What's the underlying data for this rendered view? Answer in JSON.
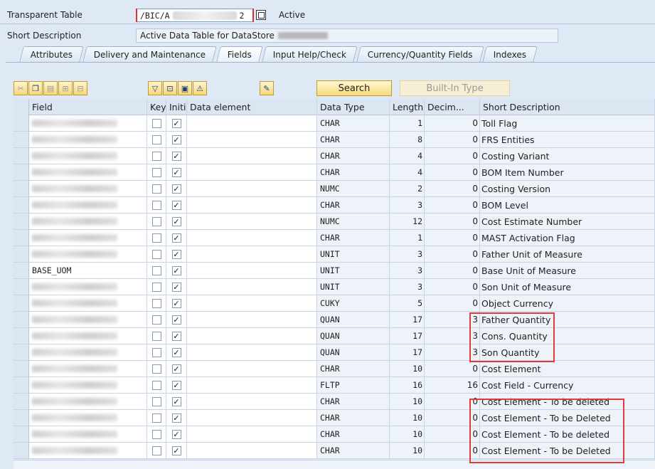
{
  "header": {
    "transparent_table_label": "Transparent Table",
    "table_name_prefix": "/BIC/A",
    "table_name_suffix": "2",
    "status": "Active",
    "short_description_label": "Short Description",
    "short_description_value": "Active Data Table for DataStore"
  },
  "tabs": [
    {
      "label": "Attributes"
    },
    {
      "label": "Delivery and Maintenance"
    },
    {
      "label": "Fields"
    },
    {
      "label": "Input Help/Check"
    },
    {
      "label": "Currency/Quantity Fields"
    },
    {
      "label": "Indexes"
    }
  ],
  "active_tab": "Fields",
  "toolbar": {
    "search_label": "Search",
    "builtin_type_label": "Built-In Type"
  },
  "columns": {
    "field": "Field",
    "key": "Key",
    "initial": "Initi...",
    "data_element": "Data element",
    "data_type": "Data Type",
    "length": "Length",
    "decimals": "Decim...",
    "short_description": "Short Description"
  },
  "rows": [
    {
      "field": "",
      "key": false,
      "initial": true,
      "data_element": "",
      "data_type": "CHAR",
      "length": "1",
      "decimals": "0",
      "short_description": "Toll Flag"
    },
    {
      "field": "",
      "key": false,
      "initial": true,
      "data_element": "",
      "data_type": "CHAR",
      "length": "8",
      "decimals": "0",
      "short_description": "FRS Entities"
    },
    {
      "field": "",
      "key": false,
      "initial": true,
      "data_element": "",
      "data_type": "CHAR",
      "length": "4",
      "decimals": "0",
      "short_description": "Costing Variant"
    },
    {
      "field": "",
      "key": false,
      "initial": true,
      "data_element": "",
      "data_type": "CHAR",
      "length": "4",
      "decimals": "0",
      "short_description": "BOM Item Number"
    },
    {
      "field": "",
      "key": false,
      "initial": true,
      "data_element": "",
      "data_type": "NUMC",
      "length": "2",
      "decimals": "0",
      "short_description": "Costing Version"
    },
    {
      "field": "",
      "key": false,
      "initial": true,
      "data_element": "",
      "data_type": "CHAR",
      "length": "3",
      "decimals": "0",
      "short_description": "BOM Level"
    },
    {
      "field": "",
      "key": false,
      "initial": true,
      "data_element": "",
      "data_type": "NUMC",
      "length": "12",
      "decimals": "0",
      "short_description": "Cost Estimate Number"
    },
    {
      "field": "",
      "key": false,
      "initial": true,
      "data_element": "",
      "data_type": "CHAR",
      "length": "1",
      "decimals": "0",
      "short_description": "MAST Activation Flag"
    },
    {
      "field": "",
      "key": false,
      "initial": true,
      "data_element": "",
      "data_type": "UNIT",
      "length": "3",
      "decimals": "0",
      "short_description": "Father Unit of Measure"
    },
    {
      "field": "BASE_UOM",
      "key": false,
      "initial": true,
      "data_element": "",
      "data_type": "UNIT",
      "length": "3",
      "decimals": "0",
      "short_description": "Base Unit of Measure"
    },
    {
      "field": "",
      "key": false,
      "initial": true,
      "data_element": "",
      "data_type": "UNIT",
      "length": "3",
      "decimals": "0",
      "short_description": "Son Unit of Measure"
    },
    {
      "field": "",
      "key": false,
      "initial": true,
      "data_element": "",
      "data_type": "CUKY",
      "length": "5",
      "decimals": "0",
      "short_description": "Object Currency"
    },
    {
      "field": "",
      "key": false,
      "initial": true,
      "data_element": "",
      "data_type": "QUAN",
      "length": "17",
      "decimals": "3",
      "short_description": "Father Quantity"
    },
    {
      "field": "",
      "key": false,
      "initial": true,
      "data_element": "",
      "data_type": "QUAN",
      "length": "17",
      "decimals": "3",
      "short_description": "Cons. Quantity"
    },
    {
      "field": "",
      "key": false,
      "initial": true,
      "data_element": "",
      "data_type": "QUAN",
      "length": "17",
      "decimals": "3",
      "short_description": "Son Quantity"
    },
    {
      "field": "",
      "key": false,
      "initial": true,
      "data_element": "",
      "data_type": "CHAR",
      "length": "10",
      "decimals": "0",
      "short_description": "Cost Element"
    },
    {
      "field": "",
      "key": false,
      "initial": true,
      "data_element": "",
      "data_type": "FLTP",
      "length": "16",
      "decimals": "16",
      "short_description": "Cost Field - Currency"
    },
    {
      "field": "",
      "key": false,
      "initial": true,
      "data_element": "",
      "data_type": "CHAR",
      "length": "10",
      "decimals": "0",
      "short_description": "Cost Element - To be deleted"
    },
    {
      "field": "",
      "key": false,
      "initial": true,
      "data_element": "",
      "data_type": "CHAR",
      "length": "10",
      "decimals": "0",
      "short_description": "Cost Element - To be Deleted"
    },
    {
      "field": "",
      "key": false,
      "initial": true,
      "data_element": "",
      "data_type": "CHAR",
      "length": "10",
      "decimals": "0",
      "short_description": "Cost Element - To be deleted"
    },
    {
      "field": "",
      "key": false,
      "initial": true,
      "data_element": "",
      "data_type": "CHAR",
      "length": "10",
      "decimals": "0",
      "short_description": "Cost Element - To be Deleted"
    }
  ],
  "colors": {
    "highlight_box": "#e03a3a",
    "background": "#dfe9f5",
    "button_fill": "#f5d77a"
  }
}
